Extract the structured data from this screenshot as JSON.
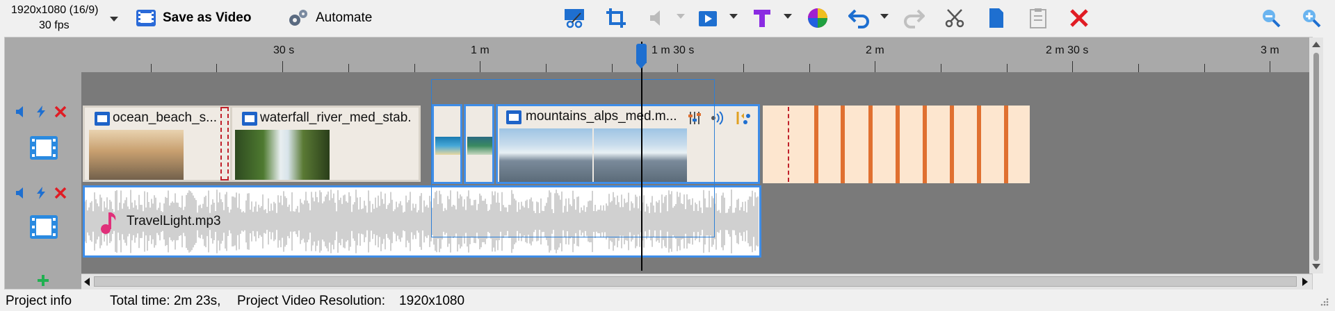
{
  "toolbar": {
    "resolution_line1": "1920x1080 (16/9)",
    "resolution_line2": "30 fps",
    "save_video_label": "Save as Video",
    "automate_label": "Automate",
    "icons": [
      "crop-video-icon",
      "crop-icon",
      "volume-icon",
      "video-effects-icon",
      "text-icon",
      "color-icon",
      "undo-icon",
      "redo-icon",
      "cut-icon",
      "copy-icon",
      "paste-icon",
      "delete-icon",
      "zoom-out-icon",
      "zoom-in-icon"
    ]
  },
  "ruler": {
    "labels": [
      "30 s",
      "1 m",
      "1 m 30 s",
      "2 m",
      "2 m 30 s",
      "3 m"
    ]
  },
  "tracks": {
    "video": {
      "clips": [
        {
          "title": "ocean_beach_s..."
        },
        {
          "title": "waterfall_river_med_stab."
        },
        {
          "title": "mountains_alps_med.m..."
        }
      ]
    },
    "audio": {
      "clip_title": "TravelLight.mp3"
    }
  },
  "status": {
    "project_info": "Project info",
    "total_time": "Total time: 2m 23s,",
    "resolution_label": "Project Video Resolution:",
    "resolution_value": "1920x1080"
  },
  "colors": {
    "accent": "#3e8de8",
    "delete": "#e01c24",
    "text_tool": "#8a2be2",
    "transition": "#e07030"
  }
}
